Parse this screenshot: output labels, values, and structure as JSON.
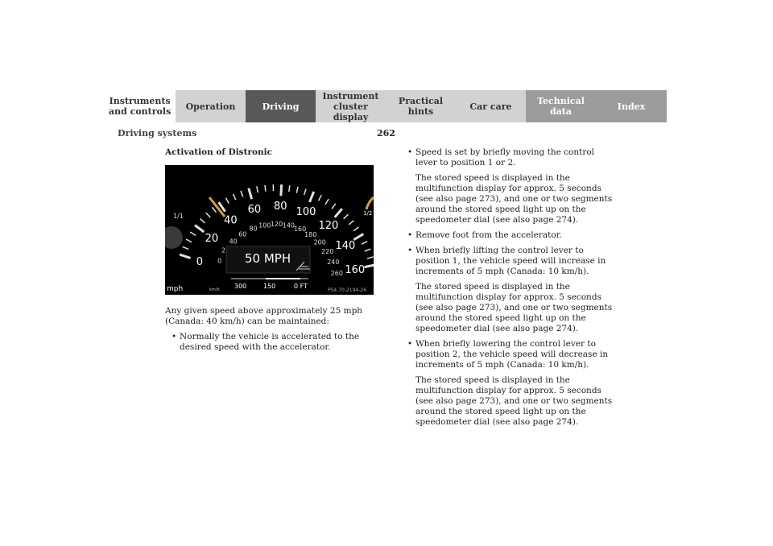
{
  "nav": {
    "tabs": [
      {
        "label": "Instruments\nand controls"
      },
      {
        "label": "Operation"
      },
      {
        "label": "Driving"
      },
      {
        "label": "Instrument\ncluster display"
      },
      {
        "label": "Practical hints"
      },
      {
        "label": "Car care"
      },
      {
        "label": "Technical\ndata"
      },
      {
        "label": "Index"
      }
    ]
  },
  "header": {
    "section": "Driving systems",
    "page_number": "262"
  },
  "left": {
    "heading": "Activation of Distronic",
    "intro": "Any given speed above approximately 25 mph (Canada: 40 km/h) can be maintained:",
    "bullet1": "Normally the vehicle is accelerated to the desired speed with the accelerator."
  },
  "figure": {
    "display_text": "50 MPH",
    "distance_labels": [
      "300",
      "150",
      "0 FT"
    ],
    "ref_code": "P54.70-2194-26",
    "mph_ticks": [
      "0",
      "20",
      "40",
      "60",
      "80",
      "100",
      "120",
      "140",
      "160"
    ],
    "kmh_ticks": [
      "0",
      "20",
      "40",
      "60",
      "80",
      "100",
      "120",
      "140",
      "160",
      "180",
      "200",
      "220",
      "240",
      "260"
    ],
    "unit_mph": "mph",
    "unit_kmh": "km/h",
    "fuel_left": "1/1",
    "fuel_right": "1/2"
  },
  "right": {
    "b1": "Speed is set by briefly moving the control lever to position 1 or 2.",
    "p1": "The stored speed is displayed in the multifunction display for approx. 5 seconds (see also page 273), and one or two segments around the stored speed light up on the speedometer dial (see also page 274).",
    "b2": "Remove foot from the accelerator.",
    "b3": "When briefly lifting the control lever to position 1, the vehicle speed will increase in increments of 5 mph (Canada: 10 km/h).",
    "p2": "The stored speed is displayed in the multifunction display for approx. 5 seconds (see also page 273), and one or two segments around the stored speed light up on the speedometer dial (see also page 274).",
    "b4": "When briefly lowering the control lever to position 2, the vehicle speed will decrease in increments of 5 mph (Canada: 10 km/h).",
    "p3": "The stored speed is displayed in the multifunction display for approx. 5 seconds (see also page 273), and one or two segments around the stored speed light up on the speedometer dial (see also page 274).",
    "bullet_char": "•"
  }
}
